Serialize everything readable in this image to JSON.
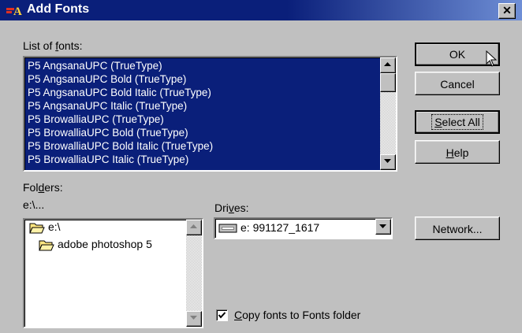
{
  "window": {
    "title": "Add Fonts",
    "close_label": "✕"
  },
  "fonts": {
    "label_pre": "List of ",
    "label_u": "f",
    "label_post": "onts:",
    "items": [
      "P5 AngsanaUPC (TrueType)",
      "P5 AngsanaUPC Bold (TrueType)",
      "P5 AngsanaUPC Bold Italic (TrueType)",
      "P5 AngsanaUPC Italic (TrueType)",
      "P5 BrowalliaUPC (TrueType)",
      "P5 BrowalliaUPC Bold (TrueType)",
      "P5 BrowalliaUPC Bold Italic (TrueType)",
      "P5 BrowalliaUPC Italic (TrueType)"
    ]
  },
  "folders": {
    "label_pre": "Fol",
    "label_u": "d",
    "label_post": "ers:",
    "current_path": "e:\\...",
    "items": [
      {
        "name": "e:\\",
        "icon": "open-folder-icon"
      },
      {
        "name": "adobe photoshop 5",
        "icon": "open-folder-icon"
      }
    ]
  },
  "drives": {
    "label_pre": "Dri",
    "label_u": "v",
    "label_post": "es:",
    "selected": "e: 991127_1617",
    "icon": "drive-icon"
  },
  "buttons": {
    "ok": "OK",
    "cancel": "Cancel",
    "select_all_u": "S",
    "select_all_rest": "elect All",
    "help_u": "H",
    "help_rest": "elp",
    "network": "Network..."
  },
  "copy_option": {
    "label_u": "C",
    "label_rest": "opy fonts to Fonts folder",
    "checked": true
  },
  "colors": {
    "titlebar": "#0a1f7a",
    "selection": "#0a1f7a",
    "face": "#c0c0c0"
  }
}
